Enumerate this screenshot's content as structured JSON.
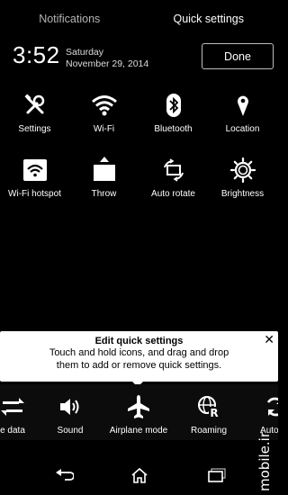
{
  "tabs": [
    {
      "label": "Notifications"
    },
    {
      "label": "Quick settings"
    }
  ],
  "header": {
    "time": "3:52",
    "day": "Saturday",
    "date": "November 29, 2014",
    "done_label": "Done"
  },
  "grid": {
    "items": [
      {
        "label": "Settings",
        "icon": "tools-icon"
      },
      {
        "label": "Wi-Fi",
        "icon": "wifi-icon"
      },
      {
        "label": "Bluetooth",
        "icon": "bluetooth-icon"
      },
      {
        "label": "Location",
        "icon": "location-pin-icon"
      },
      {
        "label": "Wi-Fi hotspot",
        "icon": "wifi-hotspot-icon"
      },
      {
        "label": "Throw",
        "icon": "throw-icon"
      },
      {
        "label": "Auto rotate",
        "icon": "auto-rotate-icon"
      },
      {
        "label": "Brightness",
        "icon": "brightness-icon"
      }
    ]
  },
  "tooltip": {
    "title": "Edit quick settings",
    "line1": "Touch and hold icons, and drag and drop",
    "line2": "them to add or remove quick settings.",
    "close": "✕"
  },
  "tray": {
    "items": [
      {
        "label": "e data",
        "icon": "mobile-data-icon"
      },
      {
        "label": "Sound",
        "icon": "speaker-icon"
      },
      {
        "label": "Airplane mode",
        "icon": "airplane-icon"
      },
      {
        "label": "Roaming",
        "icon": "roaming-icon"
      },
      {
        "label": "Auto-sy",
        "icon": "sync-icon"
      }
    ]
  },
  "watermark": "mobile.ir",
  "colors": {
    "background": "#000000",
    "tooltip_bg": "#ffffff",
    "inactive_tab": "#b3b3b3"
  }
}
